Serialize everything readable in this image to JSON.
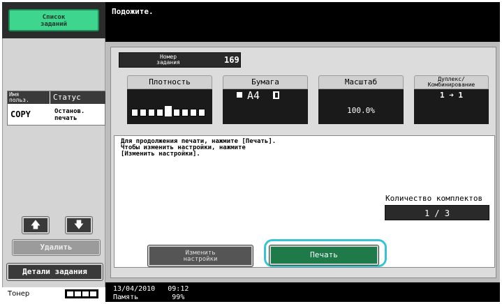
{
  "sidebar": {
    "job_list_button": "Список\nзаданий",
    "columns": {
      "user": "Имя\nпольз.",
      "status": "Статус"
    },
    "row": {
      "user": "COPY",
      "status": "Останов.\nпечать"
    },
    "up_icon": "arrow-up-icon",
    "down_icon": "arrow-down-icon",
    "delete_button": "Удалить",
    "details_button": "Детали задания",
    "toner_label": "Тонер",
    "toner_level": 1.0
  },
  "header": {
    "message": "Подожите."
  },
  "job": {
    "number_label": "Номер\nзадания",
    "number_value": "169"
  },
  "settings": {
    "density": {
      "label": "Плотность",
      "level": 5,
      "steps": 9
    },
    "paper": {
      "label": "Бумага",
      "value": "A4",
      "tray_icon": "tray-icon",
      "orientation_icon": "portrait-paper-icon"
    },
    "scale": {
      "label": "Масштаб",
      "value": "100.0%"
    },
    "duplex": {
      "label": "Дуплекс/\nКомбинирование",
      "value": "1 ➜ 1"
    }
  },
  "message": "Для продолжения печати, нажмите [Печать].\nЧтобы изменить настройки, нажмите\n[Изменить настройки].",
  "sets": {
    "label": "Количество комплектов",
    "value": "1 / 3"
  },
  "buttons": {
    "change_settings": "Изменить\nнастройки",
    "print": "Печать"
  },
  "footer": {
    "datetime": "13/04/2010   09:12",
    "memory": "Память        99%"
  },
  "colors": {
    "accent_green": "#3ed58f",
    "print_green": "#1f7a4a",
    "highlight_ring": "#38c3d4"
  }
}
